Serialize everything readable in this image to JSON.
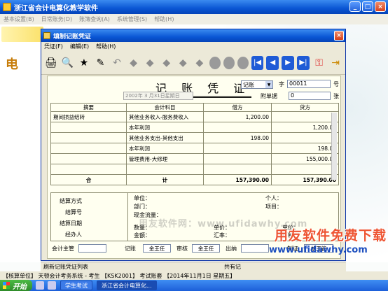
{
  "app": {
    "title": "浙江省会计电算化教学软件",
    "menu": [
      "基本设置(B)",
      "日常账务(D)",
      "账簿查询(A)",
      "系统管理(S)",
      "帮助(H)"
    ]
  },
  "dialog": {
    "title": "填制记账凭证",
    "menu": [
      "凭证(F)",
      "编辑(E)",
      "帮助(H)"
    ],
    "close_label": "×"
  },
  "voucher": {
    "heading": "记 账 凭 证",
    "type_value": "记账",
    "zi": "字",
    "number": "00011",
    "hao": "号",
    "date": "2002年 3 月31日星期日",
    "attach_label": "附单据",
    "attach_value": "0",
    "zhang": "张",
    "columns": [
      "摘要",
      "会计科目",
      "借方",
      "贷方"
    ],
    "rows": [
      {
        "summary": "期间损益结转",
        "account": "其他业务收入-服务费收入",
        "debit": "1,200.00",
        "credit": ""
      },
      {
        "summary": "",
        "account": "本年利润",
        "debit": "",
        "credit": "1,200.00"
      },
      {
        "summary": "",
        "account": "其他业务支出-其他支出",
        "debit": "198.00",
        "credit": ""
      },
      {
        "summary": "",
        "account": "本年利润",
        "debit": "",
        "credit": "198.00"
      },
      {
        "summary": "",
        "account": "管理费用-大修理",
        "debit": "",
        "credit": "155,000.00"
      },
      {
        "summary": "",
        "account": "",
        "debit": "",
        "credit": ""
      }
    ],
    "total": {
      "label1": "合",
      "label2": "计",
      "debit": "157,390.00",
      "credit": "157,390.00"
    },
    "details": {
      "settle_method": "结算方式",
      "settle_no": "结算号",
      "settle_date": "结算日期",
      "handler": "经办人",
      "unit": "单位：",
      "dept": "部门：",
      "cash_flow": "现金流量：",
      "person": "个人：",
      "project": "项目：",
      "qty": "数量：",
      "amount": "金额：",
      "price": "单价：",
      "rate": "汇率：",
      "unit_price": "单价：",
      "currency": "币种："
    },
    "signatures": {
      "supervisor": "会计主管",
      "bookkeeper": "记账",
      "bookkeeper_name": "金王任",
      "reviewer": "审核",
      "reviewer_name": "金王任",
      "cashier": "出纳",
      "maker": "制证",
      "maker_name": "胡王管"
    },
    "watermark": "用友软件网：www.ufidawhy.com"
  },
  "status": {
    "left": "刷新记账凭证列表",
    "right": "共有记"
  },
  "app_status": "【核算单位】 天顿会计考务系统 - 考生 【KSK2001】 考试账套 【2014年11月1日 星期五】",
  "brand": {
    "line1": "用友软件免费下载",
    "line2": "www.ufidawhy.com"
  },
  "taskbar": {
    "start": "开始",
    "buttons": [
      "学生考试",
      "浙江省会计电算化..."
    ]
  }
}
